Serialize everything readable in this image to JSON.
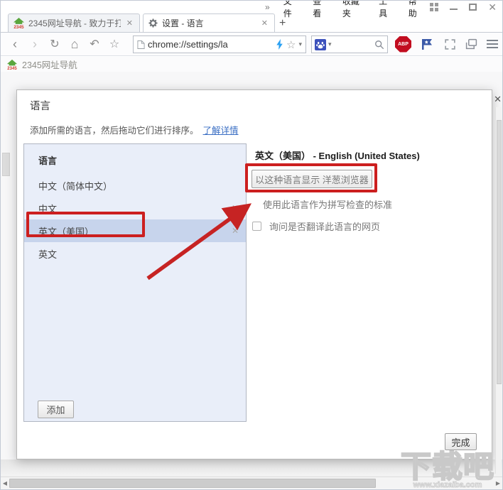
{
  "window": {
    "menu_overflow": "»",
    "menu_items": [
      "文件",
      "查看",
      "收藏夹",
      "工具",
      "帮助"
    ],
    "controls": {
      "close_glyph": "✕"
    }
  },
  "tabs": {
    "tab1": {
      "title": "2345网址导航 - 致力于打",
      "logo_text": "2345",
      "close_glyph": "✕"
    },
    "tab2": {
      "title": "设置 - 语言",
      "close_glyph": "✕"
    },
    "new_tab_glyph": "+"
  },
  "toolbar": {
    "back_glyph": "‹",
    "forward_glyph": "›",
    "refresh_glyph": "↻",
    "home_glyph": "⌂",
    "undo_glyph": "↶",
    "favorite_glyph": "☆",
    "url": "chrome://settings/la",
    "addr_star_glyph": "☆",
    "caret_glyph": "▾",
    "abp_label": "ABP"
  },
  "bookmarks": {
    "label": "2345网址导航",
    "logo_text": "2345"
  },
  "dialog": {
    "title": "语言",
    "description": "添加所需的语言，然后拖动它们进行排序。",
    "learn_more": "了解详情",
    "close_glyph": "✕",
    "list": {
      "header": "语言",
      "items": [
        {
          "label": "中文（简体中文）"
        },
        {
          "label": "中文"
        },
        {
          "label": "英文（美国）"
        },
        {
          "label": "英文"
        }
      ],
      "remove_glyph": "✕",
      "add_button": "添加"
    },
    "detail": {
      "header": "英文（美国） - English (United States)",
      "display_button": "以这种语言显示 洋葱浏览器",
      "spellcheck_label": "使用此语言作为拼写检查的标准",
      "translate_label": "询问是否翻译此语言的网页",
      "translate_checked": false
    },
    "done_button": "完成"
  },
  "scrollbars": {
    "left_arrow": "◀",
    "right_arrow": "▶"
  },
  "watermark": {
    "title": "下载吧",
    "url": "www.xiazaiba.com"
  },
  "colors": {
    "annotation_red": "#cc1f1f",
    "selection_blue": "#c7d4ec",
    "link_blue": "#3b6fc4",
    "abp_red": "#c20d20"
  }
}
